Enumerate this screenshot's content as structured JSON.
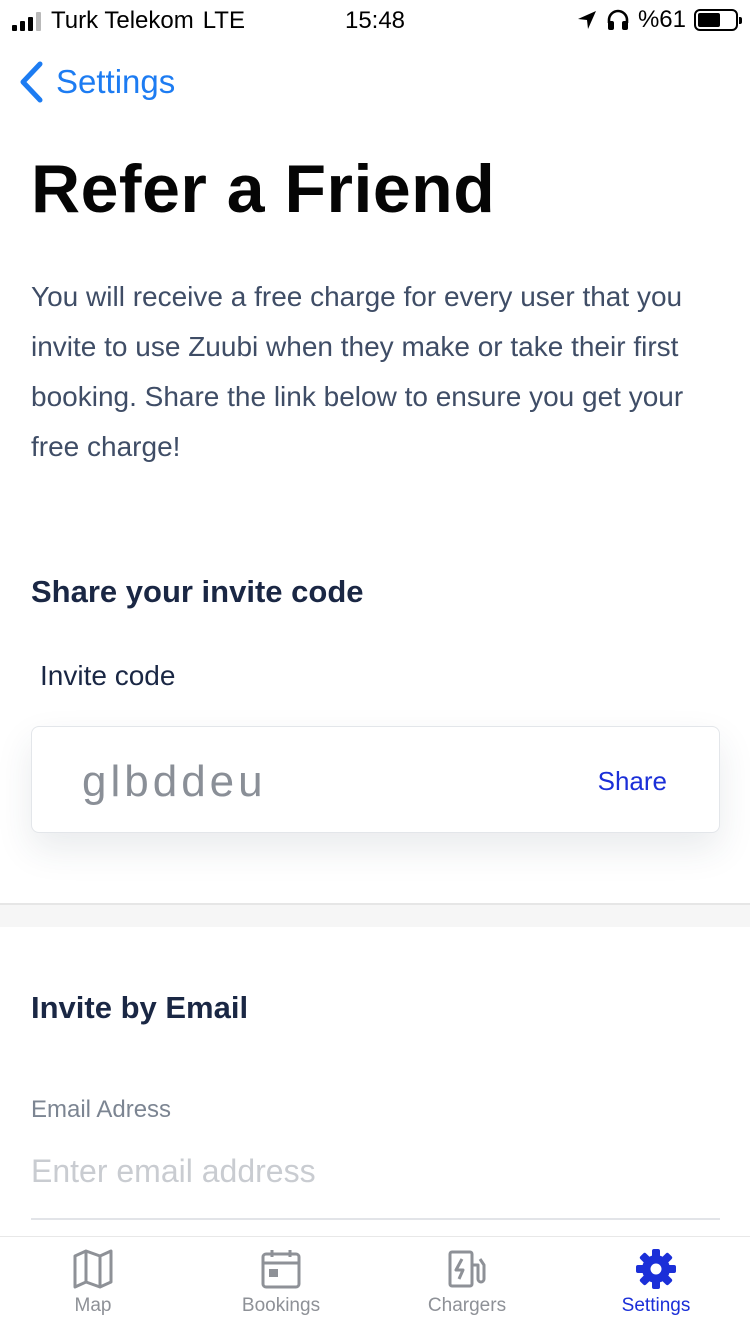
{
  "status_bar": {
    "carrier": "Turk Telekom",
    "network": "LTE",
    "time": "15:48",
    "battery": "%61",
    "battery_level": 0.61
  },
  "nav": {
    "back_label": "Settings"
  },
  "page": {
    "title": "Refer a Friend",
    "intro": "You will receive a free charge for every user that you invite to use Zuubi when they make or take their first booking. Share the link below to ensure you get your free charge!"
  },
  "share_section": {
    "heading": "Share your invite code",
    "code_label": "Invite code",
    "code_value": "glbddeu",
    "share_label": "Share"
  },
  "email_section": {
    "heading": "Invite by Email",
    "field_label": "Email Adress",
    "placeholder": "Enter email address",
    "value": ""
  },
  "tab_bar": {
    "tabs": [
      {
        "label": "Map",
        "icon": "map-icon",
        "active": false
      },
      {
        "label": "Bookings",
        "icon": "calendar-icon",
        "active": false
      },
      {
        "label": "Chargers",
        "icon": "charger-icon",
        "active": false
      },
      {
        "label": "Settings",
        "icon": "gear-icon",
        "active": true
      }
    ]
  },
  "colors": {
    "accent": "#1d7cf2",
    "active_tab": "#1b2fd8",
    "inactive_tab": "#8e9197",
    "heading": "#1a2744",
    "body_text": "#3f4d66"
  }
}
